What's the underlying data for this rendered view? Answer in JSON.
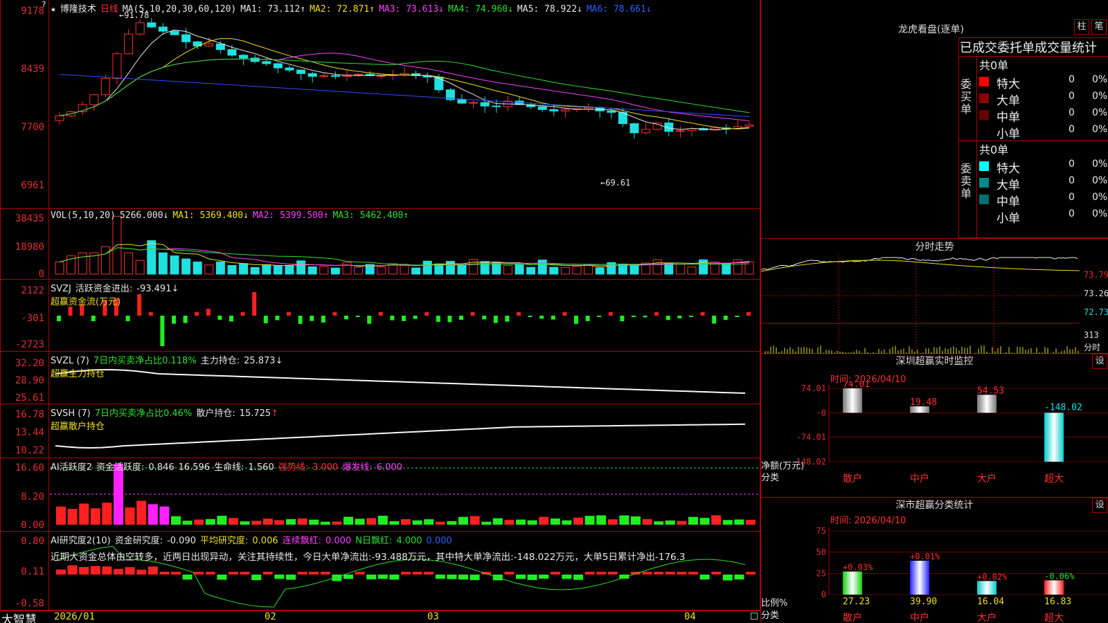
{
  "app": {
    "name": "大智慧"
  },
  "main_chart": {
    "star": "★",
    "stock_name": "博隆技术",
    "period": "日线",
    "ma_label": "MA(5,10,20,30,60,120)",
    "ma": [
      {
        "label": "MA1:",
        "value": "73.112",
        "arrow": "↑",
        "color": "#e8e8e8"
      },
      {
        "label": "MA2:",
        "value": "72.871",
        "arrow": "↑",
        "color": "#f0e020"
      },
      {
        "label": "MA3:",
        "value": "73.613",
        "arrow": "↓",
        "color": "#ff40ff"
      },
      {
        "label": "MA4:",
        "value": "74.960",
        "arrow": "↓",
        "color": "#30e030"
      },
      {
        "label": "MA5:",
        "value": "78.922",
        "arrow": "↓",
        "color": "#e8e8e8"
      },
      {
        "label": "MA6:",
        "value": "78.661",
        "arrow": "↓",
        "color": "#3060ff"
      }
    ],
    "y_ticks": [
      "9178",
      "8439",
      "7700",
      "6961"
    ],
    "high_label": "91.78",
    "low_label": "69.61"
  },
  "vol": {
    "header": "VOL(5,10,20)",
    "value": "5266.000",
    "arrow": "↓",
    "ma": [
      {
        "label": "MA1:",
        "value": "5369.400",
        "arrow": "↓",
        "color": "#f0e020"
      },
      {
        "label": "MA2:",
        "value": "5399.500",
        "arrow": "↑",
        "color": "#ff40ff"
      },
      {
        "label": "MA3:",
        "value": "5462.400",
        "arrow": "↑",
        "color": "#30e030"
      }
    ],
    "y_ticks": [
      "38435",
      "18980",
      "0"
    ]
  },
  "svzj": {
    "header": "SVZJ",
    "label": "活跃资金进出:",
    "value": "-93.491",
    "arrow": "↓",
    "sub": "超赢资金流(万元)",
    "y_ticks": [
      "2122",
      "-301",
      "-2723"
    ]
  },
  "svzl": {
    "header": "SVZL (7)",
    "desc": "7日内买卖净占比0.118%",
    "label": "主力持仓:",
    "value": "25.873",
    "arrow": "↓",
    "sub": "超赢主力持仓",
    "y_ticks": [
      "32.20",
      "28.90",
      "25.61"
    ]
  },
  "svsh": {
    "header": "SVSH (7)",
    "desc": "7日内买卖净占比0.46%",
    "label": "散户持仓:",
    "value": "15.725",
    "arrow": "↑",
    "sub": "超赢散户持仓",
    "y_ticks": [
      "16.78",
      "13.44",
      "10.22"
    ]
  },
  "ai_active": {
    "header": "AI活跃度2",
    "label": "资金活跃度:",
    "value": "0.846",
    "v2": "16.596",
    "life_label": "生命线:",
    "life": "1.560",
    "strong_label": "强势线:",
    "strong": "3.000",
    "burst_label": "爆发线:",
    "burst": "6.000",
    "y_ticks": [
      "16.60",
      "8.20",
      "0.00"
    ]
  },
  "ai_research": {
    "header": "AI研究度2(10)",
    "label": "资金研究度:",
    "value": "-0.090",
    "avg_label": "平均研究度:",
    "avg": "0.006",
    "cont_label": "连续飘红:",
    "cont": "0.000",
    "n_label": "N日飘红:",
    "n": "4.000",
    "extra": "0.000",
    "note": "近期大资金总体由空转多，近两日出现异动，关注其持续性，今日大单净流出:-93.488万元，其中特大单净流出:-148.022万元，大单5日累计净出-176.3",
    "y_ticks": [
      "0.80",
      "0.11",
      "-0.58"
    ]
  },
  "x_axis": [
    "2026/01",
    "02",
    "03",
    "04"
  ],
  "dragon": {
    "title": "龙虎看盘(逐单)",
    "btn1": "柱",
    "btn2": "笔",
    "subtitle": "已成交委托单成交量统计",
    "buy": {
      "label": "委买单",
      "total": "共0单",
      "rows": [
        {
          "name": "特大",
          "count": "0",
          "pct": "0%",
          "color": "#ff0000"
        },
        {
          "name": "大单",
          "count": "0",
          "pct": "0%",
          "color": "#8b0000"
        },
        {
          "name": "中单",
          "count": "0",
          "pct": "0%",
          "color": "#6b0000"
        },
        {
          "name": "小单",
          "count": "0",
          "pct": "0%",
          "color": ""
        }
      ]
    },
    "sell": {
      "label": "委卖单",
      "total": "共0单",
      "rows": [
        {
          "name": "特大",
          "count": "0",
          "pct": "0%",
          "color": "#00ffff"
        },
        {
          "name": "大单",
          "count": "0",
          "pct": "0%",
          "color": "#008b8b"
        },
        {
          "name": "中单",
          "count": "0",
          "pct": "0%",
          "color": "#007070"
        },
        {
          "name": "小单",
          "count": "0",
          "pct": "0%",
          "color": ""
        }
      ]
    }
  },
  "intraday": {
    "title": "分时走势",
    "y_ticks": [
      "73.79",
      "73.26",
      "72.73"
    ],
    "vol_ticks": [
      "313",
      "分时"
    ]
  },
  "sz_monitor": {
    "title": "深圳超赢实时监控",
    "set_btn": "设",
    "time": "时间: 2026/04/10",
    "y_ticks": [
      "74.01",
      "-0",
      "-74.01",
      "-148.02"
    ],
    "y_label": "净额(万元)",
    "x_label": "分类",
    "chart_data": {
      "type": "bar",
      "categories": [
        "散户",
        "中户",
        "大户",
        "超大"
      ],
      "values": [
        74.01,
        19.48,
        54.53,
        -148.02
      ],
      "value_labels": [
        "74.01",
        "19.48",
        "54.53",
        "-148.02"
      ],
      "ylabel": "净额(万元)",
      "xlabel": "分类",
      "ylim": [
        -148.02,
        74.01
      ]
    }
  },
  "sz_class": {
    "title": "深市超赢分类统计",
    "set_btn": "设",
    "time": "时间: 2026/04/10",
    "y_ticks": [
      "75",
      "50",
      "25",
      "0"
    ],
    "y_label": "比例%",
    "x_label": "分类",
    "chart_data": {
      "type": "bar",
      "categories": [
        "散户",
        "中户",
        "大户",
        "超大"
      ],
      "values": [
        27.23,
        39.9,
        16.04,
        16.83
      ],
      "changes": [
        "+0.03%",
        "+0.01%",
        "+0.02%",
        "-0.06%"
      ],
      "ylabel": "比例%",
      "xlabel": "分类",
      "ylim": [
        0,
        75
      ]
    }
  },
  "colors": {
    "up": "#ff3030",
    "down": "#20e0e0",
    "frame": "#b00000",
    "yellow": "#f0e020"
  }
}
